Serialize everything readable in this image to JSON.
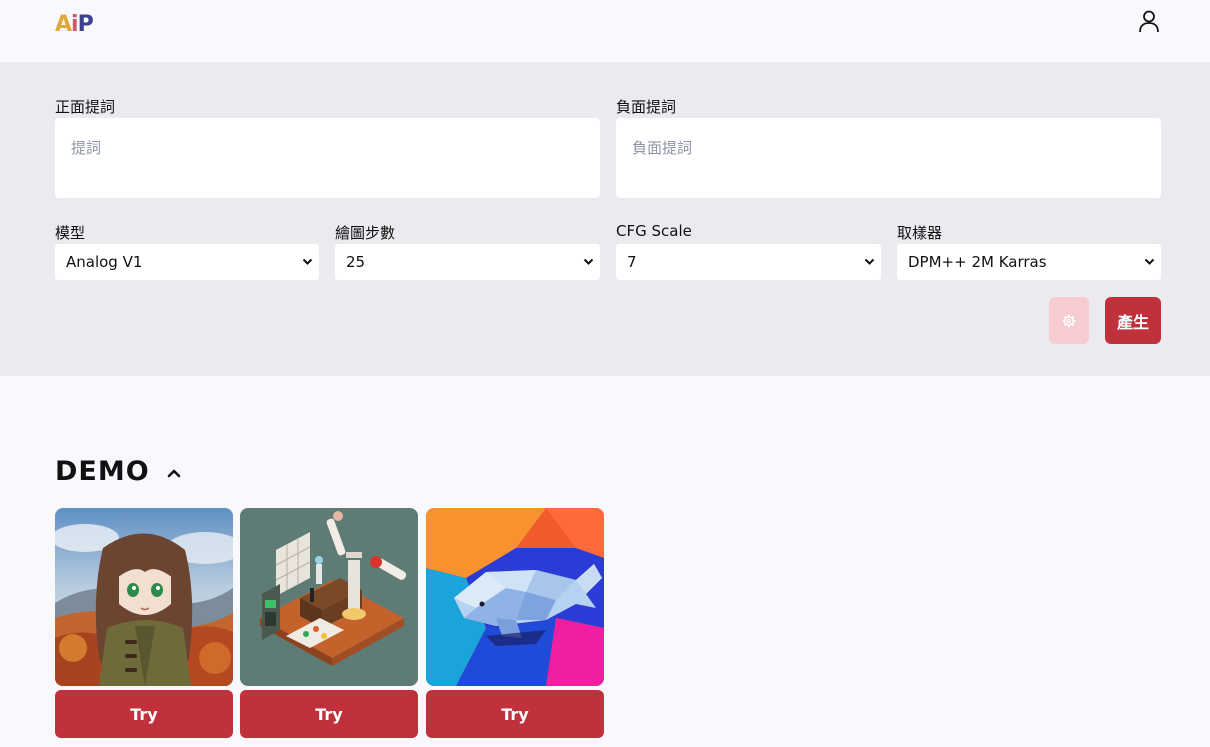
{
  "header": {
    "logo": {
      "a": "A",
      "i": "i",
      "p": "P"
    },
    "user_icon": "user-icon"
  },
  "form": {
    "positive": {
      "label": "正面提詞",
      "placeholder": "提詞"
    },
    "negative": {
      "label": "負面提詞",
      "placeholder": "負面提詞"
    },
    "model": {
      "label": "模型",
      "value": "Analog V1"
    },
    "steps": {
      "label": "繪圖步數",
      "value": "25"
    },
    "cfg": {
      "label": "CFG Scale",
      "value": "7"
    },
    "sampler": {
      "label": "取樣器",
      "value": "DPM++ 2M Karras"
    },
    "settings_icon": "gear-icon",
    "generate_label": "產生"
  },
  "demo": {
    "title": "DEMO",
    "toggle_icon": "chevron-up-icon",
    "items": [
      {
        "image": "anime-girl-autumn",
        "try_label": "Try"
      },
      {
        "image": "isometric-lab-room",
        "try_label": "Try"
      },
      {
        "image": "lowpoly-whale",
        "try_label": "Try"
      }
    ]
  },
  "colors": {
    "accent": "#c0313b",
    "accent_light": "#f7ccd0",
    "panel_bg": "#ebeaee",
    "page_bg": "#f9f8fc"
  }
}
